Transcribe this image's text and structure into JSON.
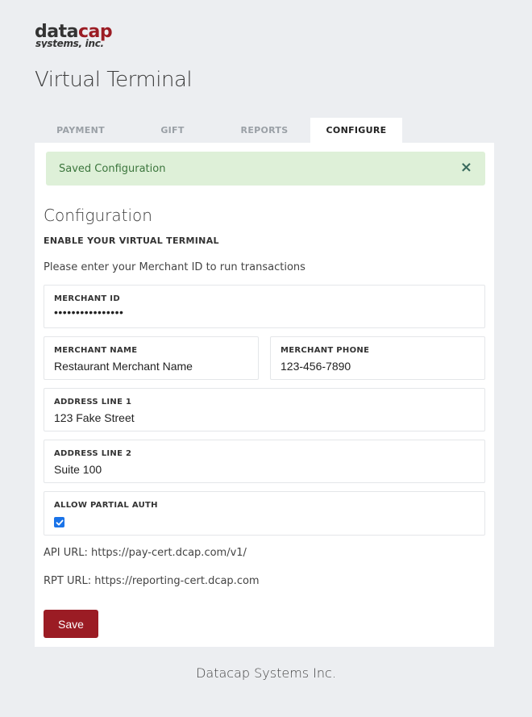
{
  "logo": {
    "text_top": "datacap",
    "text_bottom": "systems, inc.",
    "brand_color": "#9b1c24",
    "dark_color": "#333333"
  },
  "page_title": "Virtual Terminal",
  "tabs": [
    {
      "label": "PAYMENT",
      "active": false
    },
    {
      "label": "GIFT",
      "active": false
    },
    {
      "label": "REPORTS",
      "active": false
    },
    {
      "label": "CONFIGURE",
      "active": true
    }
  ],
  "alert": {
    "message": "Saved Configuration",
    "close_icon": "×",
    "color": "#3c763d",
    "background": "#def0d8"
  },
  "config": {
    "title": "Configuration",
    "subhead": "ENABLE YOUR VIRTUAL TERMINAL",
    "instructions": "Please enter your Merchant ID to run transactions"
  },
  "fields": {
    "merchant_id": {
      "label": "MERCHANT ID",
      "value": "••••••••••••••••"
    },
    "merchant_name": {
      "label": "MERCHANT NAME",
      "value": "Restaurant Merchant Name"
    },
    "merchant_phone": {
      "label": "MERCHANT PHONE",
      "value": "123-456-7890"
    },
    "address_line_1": {
      "label": "ADDRESS LINE 1",
      "value": "123 Fake Street"
    },
    "address_line_2": {
      "label": "ADDRESS LINE 2",
      "value": "Suite 100"
    },
    "allow_partial_auth": {
      "label": "ALLOW PARTIAL AUTH",
      "checked": true
    }
  },
  "urls": {
    "api": "API URL: https://pay-cert.dcap.com/v1/",
    "rpt": "RPT URL: https://reporting-cert.dcap.com"
  },
  "save_label": "Save",
  "footer": "Datacap Systems Inc.",
  "colors": {
    "accent": "#9b1c24",
    "page_bg": "#eceef1",
    "checkbox": "#1a73e8"
  }
}
